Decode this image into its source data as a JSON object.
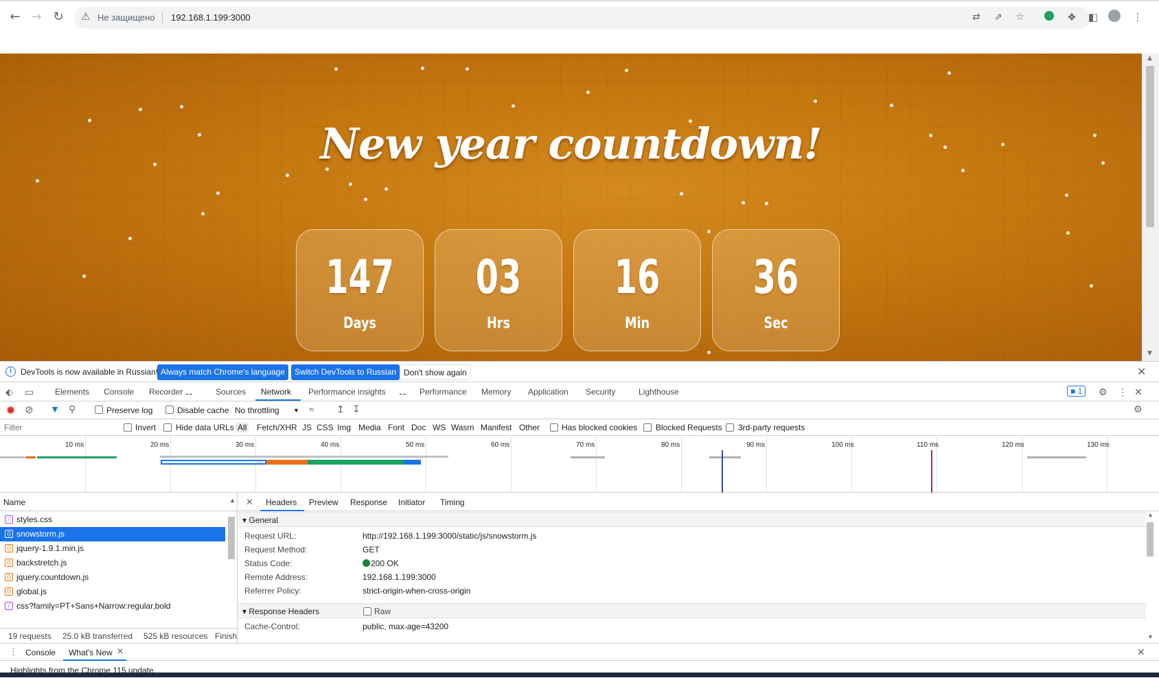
{
  "browser": {
    "security_label": "Не защищено",
    "url": "192.168.1.199:3000"
  },
  "page": {
    "title": "New year countdown!",
    "countdown": [
      {
        "value": "147",
        "label": "Days"
      },
      {
        "value": "03",
        "label": "Hrs"
      },
      {
        "value": "16",
        "label": "Min"
      },
      {
        "value": "36",
        "label": "Sec"
      }
    ]
  },
  "devtools": {
    "infobar": {
      "message": "DevTools is now available in Russian!",
      "btn_match": "Always match Chrome's language",
      "btn_switch": "Switch DevTools to Russian",
      "btn_dismiss": "Don't show again"
    },
    "tabs": [
      "Elements",
      "Console",
      "Recorder",
      "Sources",
      "Network",
      "Performance insights",
      "Performance",
      "Memory",
      "Application",
      "Security",
      "Lighthouse"
    ],
    "active_tab": "Network",
    "issues_count": "1",
    "network_toolbar": {
      "preserve_log": "Preserve log",
      "disable_cache": "Disable cache",
      "throttling": "No throttling"
    },
    "filter": {
      "placeholder": "Filter",
      "invert": "Invert",
      "hide_data_urls": "Hide data URLs",
      "types": [
        "All",
        "Fetch/XHR",
        "JS",
        "CSS",
        "Img",
        "Media",
        "Font",
        "Doc",
        "WS",
        "Wasm",
        "Manifest",
        "Other"
      ],
      "has_blocked_cookies": "Has blocked cookies",
      "blocked_requests": "Blocked Requests",
      "third_party": "3rd-party requests"
    },
    "timeline_ticks": [
      "10 ms",
      "20 ms",
      "30 ms",
      "40 ms",
      "50 ms",
      "60 ms",
      "70 ms",
      "80 ms",
      "90 ms",
      "100 ms",
      "110 ms",
      "120 ms",
      "130 ms"
    ],
    "request_list": {
      "column": "Name",
      "rows": [
        {
          "name": "styles.css",
          "type": "css"
        },
        {
          "name": "snowstorm.js",
          "type": "js"
        },
        {
          "name": "jquery-1.9.1.min.js",
          "type": "js"
        },
        {
          "name": "backstretch.js",
          "type": "js"
        },
        {
          "name": "jquery.countdown.js",
          "type": "js"
        },
        {
          "name": "global.js",
          "type": "js"
        },
        {
          "name": "css?family=PT+Sans+Narrow:regular,bold",
          "type": "css"
        }
      ],
      "selected": "snowstorm.js"
    },
    "summary": {
      "requests": "19 requests",
      "transferred": "25.0 kB transferred",
      "resources": "525 kB resources",
      "finish": "Finish"
    },
    "detail_tabs": [
      "Headers",
      "Preview",
      "Response",
      "Initiator",
      "Timing"
    ],
    "general_label": "General",
    "general": [
      {
        "key": "Request URL:",
        "value": "http://192.168.1.199:3000/static/js/snowstorm.js"
      },
      {
        "key": "Request Method:",
        "value": "GET"
      },
      {
        "key": "Status Code:",
        "value": "200 OK"
      },
      {
        "key": "Remote Address:",
        "value": "192.168.1.199:3000"
      },
      {
        "key": "Referrer Policy:",
        "value": "strict-origin-when-cross-origin"
      }
    ],
    "response_headers_label": "Response Headers",
    "raw_label": "Raw",
    "response_headers": [
      {
        "key": "Cache-Control:",
        "value": "public, max-age=43200"
      }
    ],
    "drawer": {
      "tabs": [
        "Console",
        "What's New"
      ],
      "whats_new": "Highlights from the Chrome 115 update"
    }
  },
  "colors": {
    "accent": "#1a73e8",
    "status_ok": "#188038",
    "page_orange": "#c4760f"
  }
}
